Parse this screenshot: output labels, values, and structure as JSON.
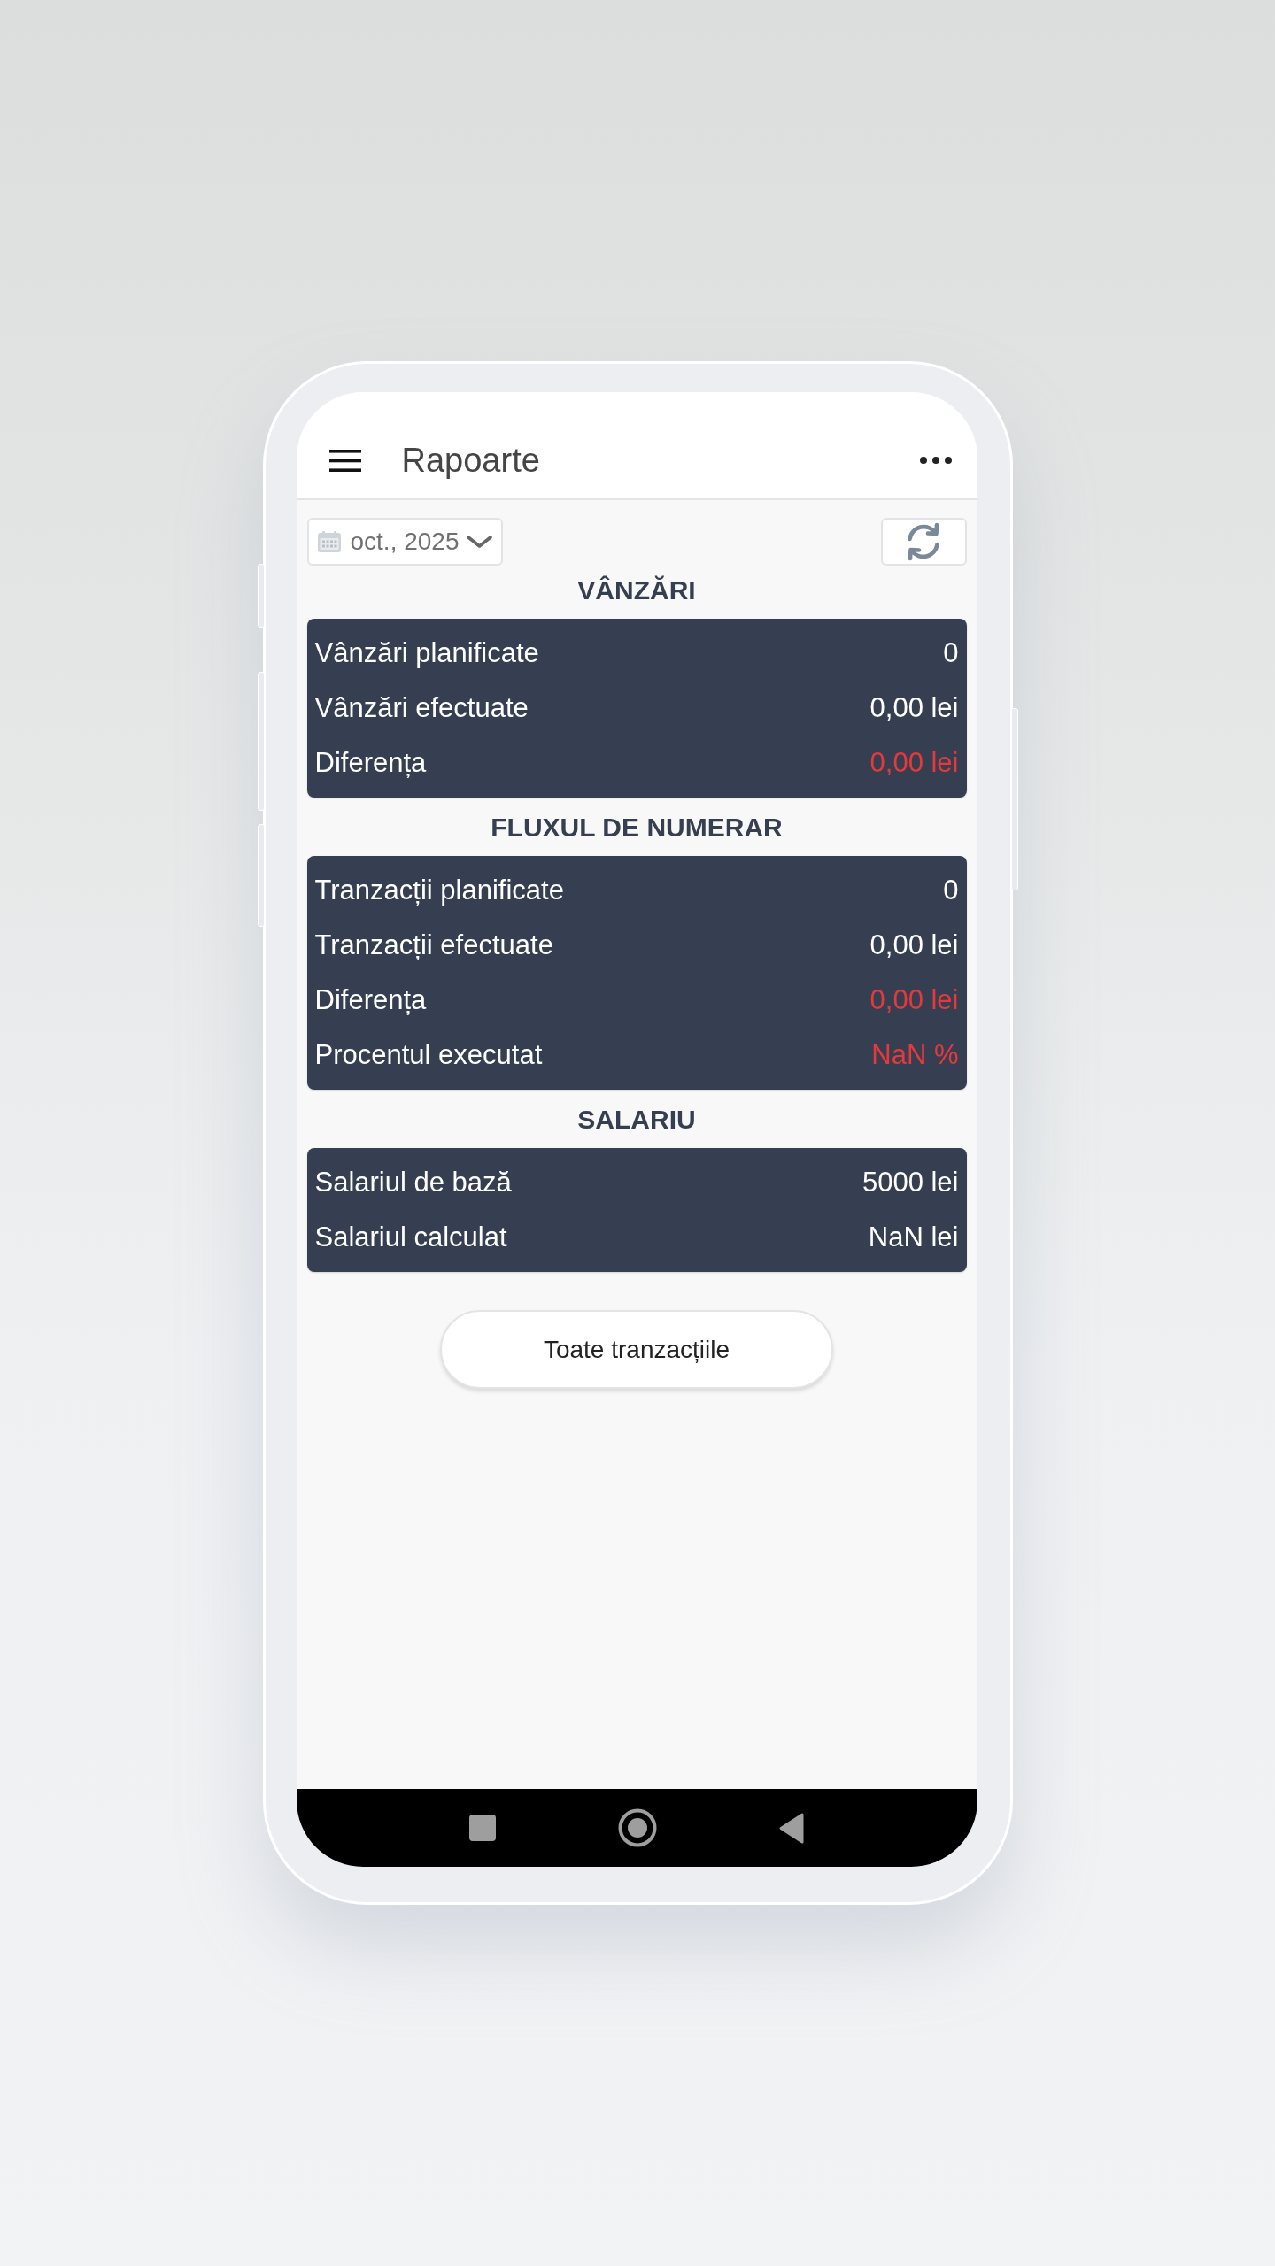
{
  "app_bar": {
    "title": "Rapoarte"
  },
  "toolbar": {
    "date_picker": {
      "value": "oct., 2025"
    }
  },
  "sections": [
    {
      "title": "VÂNZĂRI",
      "rows": [
        {
          "label": "Vânzări planificate",
          "value": "0",
          "alert": false
        },
        {
          "label": "Vânzări efectuate",
          "value": "0,00 lei",
          "alert": false
        },
        {
          "label": "Diferența",
          "value": "0,00 lei",
          "alert": true
        }
      ]
    },
    {
      "title": "FLUXUL DE NUMERAR",
      "rows": [
        {
          "label": "Tranzacții planificate",
          "value": "0",
          "alert": false
        },
        {
          "label": "Tranzacții efectuate",
          "value": "0,00 lei",
          "alert": false
        },
        {
          "label": "Diferența",
          "value": "0,00 lei",
          "alert": true
        },
        {
          "label": "Procentul executat",
          "value": "NaN %",
          "alert": true
        }
      ]
    },
    {
      "title": "SALARIU",
      "rows": [
        {
          "label": "Salariul de bază",
          "value": "5000 lei",
          "alert": false
        },
        {
          "label": "Salariul calculat",
          "value": "NaN lei",
          "alert": false
        }
      ]
    }
  ],
  "all_transactions_button": {
    "label": "Toate tranzacțiile"
  }
}
